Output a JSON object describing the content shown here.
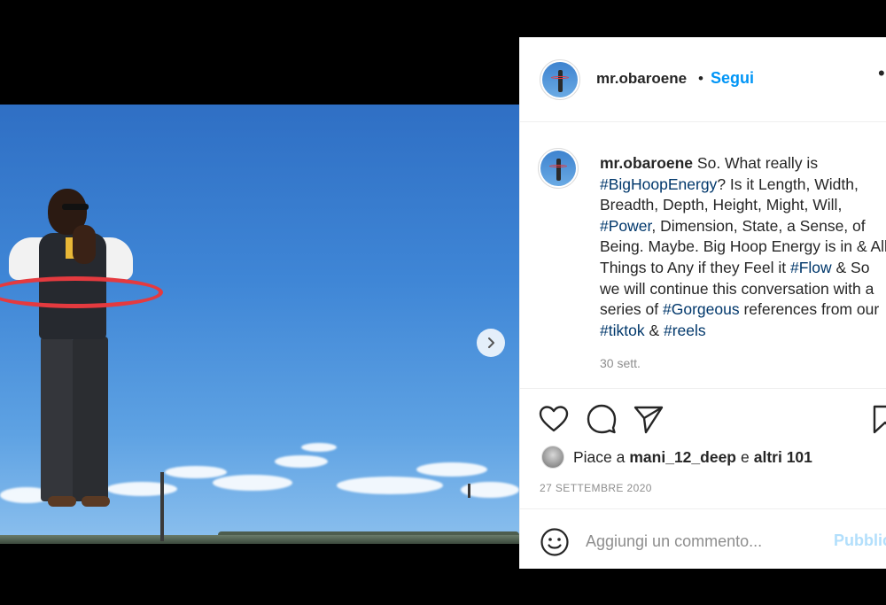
{
  "post": {
    "username": "mr.obaroene",
    "dot": "•",
    "follow_label": "Segui",
    "more": "•",
    "caption_intro": " So. What really is ",
    "tag_bighoop": "#BigHoopEnergy",
    "caption_p2": "? Is it Length, Width, Breadth, Depth, Height, Might, Will, ",
    "tag_power": "#Power",
    "caption_p3": ", Dimension, State, a Sense, of Being. Maybe. Big Hoop Energy is in & All Things to Any if they Feel it ",
    "tag_flow": "#Flow",
    "caption_p4": " & So we will continue this conversation with a series of ",
    "tag_gorgeous": "#Gorgeous",
    "caption_p5": " references from our ",
    "tag_tiktok": "#tiktok",
    "caption_p6": " & ",
    "tag_reels": "#reels",
    "time_ago": "30 sett.",
    "likes_prefix": "Piace a",
    "likes_user": "mani_12_deep",
    "likes_mid": "e",
    "likes_others": "altri 101",
    "date": "27 SETTEMBRE 2020"
  },
  "comment": {
    "placeholder": "Aggiungi un commento...",
    "publish_label": "Pubblica"
  },
  "icons": {
    "like": "heart-icon",
    "comment": "comment-icon",
    "share": "send-icon",
    "save": "bookmark-icon",
    "emoji": "emoji-icon",
    "next": "chevron-right-icon"
  },
  "colors": {
    "accent": "#0095f6",
    "hashtag": "#00376b",
    "hoop": "#e43a3f"
  }
}
